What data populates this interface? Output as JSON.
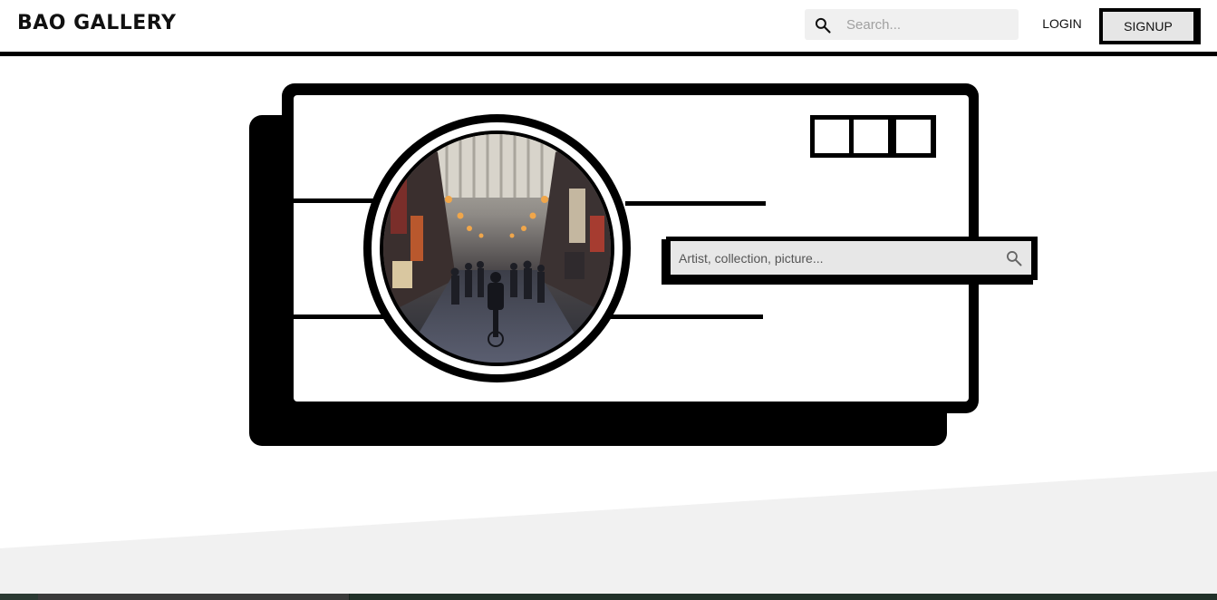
{
  "header": {
    "brand": "BAO GALLERY",
    "search": {
      "placeholder": "Search..."
    },
    "login_label": "LOGIN",
    "signup_label": "SIGNUP"
  },
  "hero": {
    "search": {
      "placeholder": "Artist, collection, picture..."
    }
  },
  "icons": {
    "header_search": "search-icon",
    "hero_search": "search-icon"
  },
  "colors": {
    "ink": "#000000",
    "field_bg": "#f0f0f0",
    "signup_bg": "#e6e6e6",
    "footer_slope": "#f1f1f1"
  }
}
